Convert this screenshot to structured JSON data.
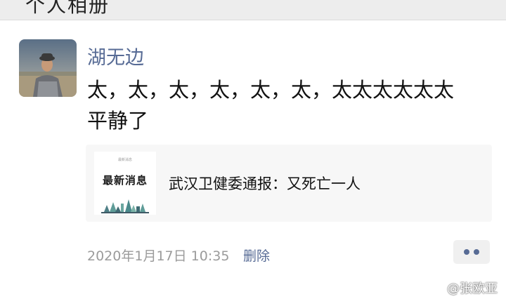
{
  "header": {
    "title": "个人相册"
  },
  "post": {
    "author": "湖无边",
    "text": "太，太，太，太，太，太，太太太太太太\n平静了",
    "link_card": {
      "thumbnail_title": "最新消息",
      "thumbnail_caption": "最新消息",
      "title": "武汉卫健委通报：又死亡一人"
    },
    "timestamp": "2020年1月17日 10:35",
    "delete_label": "删除"
  },
  "watermark": {
    "text": "@张欧亚",
    "icon": "weibo-logo-icon"
  },
  "colors": {
    "link": "#576b95",
    "meta": "#9b9b9b",
    "card_bg": "#f7f7f7"
  }
}
